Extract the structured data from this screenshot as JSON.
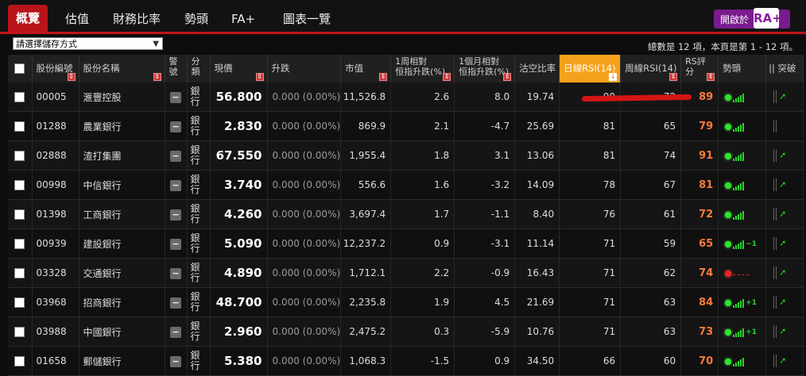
{
  "nav": {
    "tabs": [
      "概覽",
      "估值",
      "財務比率",
      "勢頭",
      "FA+",
      "圖表一覽"
    ],
    "active_index": 0,
    "ra_button_label": "開啟於",
    "ra_logo": "RA+"
  },
  "controls": {
    "sort_select_value": "請選擇儲存方式",
    "page_info": "總數是 12 項，本頁是第 1 - 12 項。"
  },
  "table": {
    "headers": {
      "code": "股份編號",
      "name": "股份名稱",
      "warning": [
        "警",
        "號"
      ],
      "category": [
        "分",
        "類"
      ],
      "price": "現價",
      "change": "升跌",
      "mktcap": "市值",
      "week_rel": [
        "1周相對",
        "恒指升跌(%)"
      ],
      "month_rel": [
        "1個月相對",
        "恒指升跌(%)"
      ],
      "short_ratio": "沽空比率",
      "daily_rsi": "日線RSI(14)",
      "weekly_rsi": "周線RSI(14)",
      "rs_score": [
        "RS評",
        "分"
      ],
      "momentum": "勢頭",
      "breakout": "|| 突破"
    },
    "sorted_column": "daily_rsi",
    "rows": [
      {
        "code": "00005",
        "name": "滙豐控股",
        "category": [
          "銀",
          "行"
        ],
        "price": "56.800",
        "change": "0.000 (0.00%)",
        "mktcap": "11,526.8",
        "week": "2.6",
        "month": "8.0",
        "short": "19.74",
        "drsi": "90",
        "wrsi": "72",
        "rs": "89",
        "mom": "bars",
        "brk": "up"
      },
      {
        "code": "01288",
        "name": "農業銀行",
        "category": [
          "銀",
          "行"
        ],
        "price": "2.830",
        "change": "0.000 (0.00%)",
        "mktcap": "869.9",
        "week": "2.1",
        "month": "-4.7",
        "short": "25.69",
        "drsi": "81",
        "wrsi": "65",
        "rs": "79",
        "mom": "bars",
        "brk": "none"
      },
      {
        "code": "02888",
        "name": "渣打集團",
        "category": [
          "銀",
          "行"
        ],
        "price": "67.550",
        "change": "0.000 (0.00%)",
        "mktcap": "1,955.4",
        "week": "1.8",
        "month": "3.1",
        "short": "13.06",
        "drsi": "81",
        "wrsi": "74",
        "rs": "91",
        "mom": "bars",
        "brk": "up"
      },
      {
        "code": "00998",
        "name": "中信銀行",
        "category": [
          "銀",
          "行"
        ],
        "price": "3.740",
        "change": "0.000 (0.00%)",
        "mktcap": "556.6",
        "week": "1.6",
        "month": "-3.2",
        "short": "14.09",
        "drsi": "78",
        "wrsi": "67",
        "rs": "81",
        "mom": "bars",
        "brk": "up"
      },
      {
        "code": "01398",
        "name": "工商銀行",
        "category": [
          "銀",
          "行"
        ],
        "price": "4.260",
        "change": "0.000 (0.00%)",
        "mktcap": "3,697.4",
        "week": "1.7",
        "month": "-1.1",
        "short": "8.40",
        "drsi": "76",
        "wrsi": "61",
        "rs": "72",
        "mom": "bars",
        "brk": "up"
      },
      {
        "code": "00939",
        "name": "建設銀行",
        "category": [
          "銀",
          "行"
        ],
        "price": "5.090",
        "change": "0.000 (0.00%)",
        "mktcap": "12,237.2",
        "week": "0.9",
        "month": "-3.1",
        "short": "11.14",
        "drsi": "71",
        "wrsi": "59",
        "rs": "65",
        "mom": "bars-1",
        "brk": "up"
      },
      {
        "code": "03328",
        "name": "交通銀行",
        "category": [
          "銀",
          "行"
        ],
        "price": "4.890",
        "change": "0.000 (0.00%)",
        "mktcap": "1,712.1",
        "week": "2.2",
        "month": "-0.9",
        "short": "16.43",
        "drsi": "71",
        "wrsi": "62",
        "rs": "74",
        "mom": "red",
        "brk": "up"
      },
      {
        "code": "03968",
        "name": "招商銀行",
        "category": [
          "銀",
          "行"
        ],
        "price": "48.700",
        "change": "0.000 (0.00%)",
        "mktcap": "2,235.8",
        "week": "1.9",
        "month": "4.5",
        "short": "21.69",
        "drsi": "71",
        "wrsi": "63",
        "rs": "84",
        "mom": "bars+1",
        "brk": "up"
      },
      {
        "code": "03988",
        "name": "中國銀行",
        "category": [
          "銀",
          "行"
        ],
        "price": "2.960",
        "change": "0.000 (0.00%)",
        "mktcap": "2,475.2",
        "week": "0.3",
        "month": "-5.9",
        "short": "10.76",
        "drsi": "71",
        "wrsi": "63",
        "rs": "73",
        "mom": "bars+1",
        "brk": "up"
      },
      {
        "code": "01658",
        "name": "郵儲銀行",
        "category": [
          "銀",
          "行"
        ],
        "price": "5.380",
        "change": "0.000 (0.00%)",
        "mktcap": "1,068.3",
        "week": "-1.5",
        "month": "0.9",
        "short": "34.50",
        "drsi": "66",
        "wrsi": "60",
        "rs": "70",
        "mom": "bars",
        "brk": "up"
      }
    ],
    "warning_symbol": "−",
    "trend_labels": {
      "minus": "−1",
      "plus": "+1"
    },
    "colors": {
      "accent_red": "#c0161c",
      "sorted_header": "#f6a11c",
      "rs_orange": "#ff7a3c",
      "trend_green": "#2ccf2c",
      "annotation_red": "#d41515"
    }
  }
}
